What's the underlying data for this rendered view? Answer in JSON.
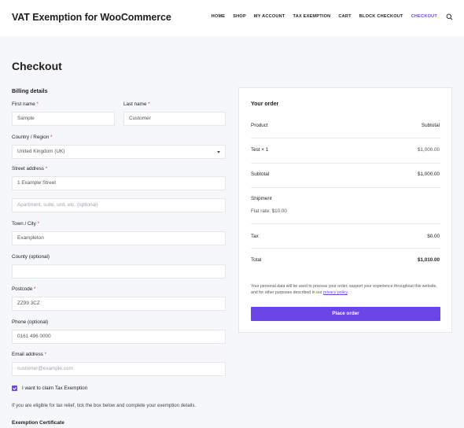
{
  "header": {
    "site_title": "VAT Exemption for WooCommerce",
    "nav": [
      "HOME",
      "SHOP",
      "MY ACCOUNT",
      "TAX EXEMPTION",
      "CART",
      "BLOCK CHECKOUT",
      "CHECKOUT"
    ],
    "active_nav": "CHECKOUT",
    "accent_color": "#6b45e6"
  },
  "page": {
    "title": "Checkout"
  },
  "billing": {
    "heading": "Billing details",
    "first_name": {
      "label": "First name",
      "value": "Sample"
    },
    "last_name": {
      "label": "Last name",
      "value": "Customer"
    },
    "country": {
      "label": "Country / Region",
      "value": "United Kingdom (UK)"
    },
    "street": {
      "label": "Street address",
      "value": "1 Example Street"
    },
    "apartment": {
      "placeholder": "Apartment, suite, unit, etc. (optional)"
    },
    "town": {
      "label": "Town / City",
      "value": "Exampleton"
    },
    "county": {
      "label": "County (optional)",
      "value": ""
    },
    "postcode": {
      "label": "Postcode",
      "value": "ZZ99 3CZ"
    },
    "phone": {
      "label": "Phone (optional)",
      "value": "0161 496 0000"
    },
    "email": {
      "label": "Email address",
      "value": "customer@example.com"
    },
    "required_mark": "*"
  },
  "tax": {
    "checkbox_label": "I want to claim Tax Exemption",
    "checked": true,
    "help": "If you are eligible for tax relief, tick the box below and complete your exemption details.",
    "certificate_heading": "Exemption Certificate"
  },
  "order": {
    "title": "Your order",
    "col_product": "Product",
    "col_subtotal": "Subtotal",
    "item_name": "Test",
    "item_qty": "× 1",
    "item_price": "$1,000.00",
    "subtotal_label": "Subtotal",
    "subtotal_value": "$1,000.00",
    "shipment_label": "Shipment",
    "shipment_method": "Flat rate: $10.00",
    "tax_label": "Tax",
    "tax_value": "$0.00",
    "total_label": "Total",
    "total_value": "$1,010.00",
    "privacy_text": "Your personal data will be used to process your order, support your experience throughout this website, and for other purposes described in our",
    "privacy_link": "privacy policy",
    "privacy_end": ".",
    "place_order": "Place order"
  }
}
